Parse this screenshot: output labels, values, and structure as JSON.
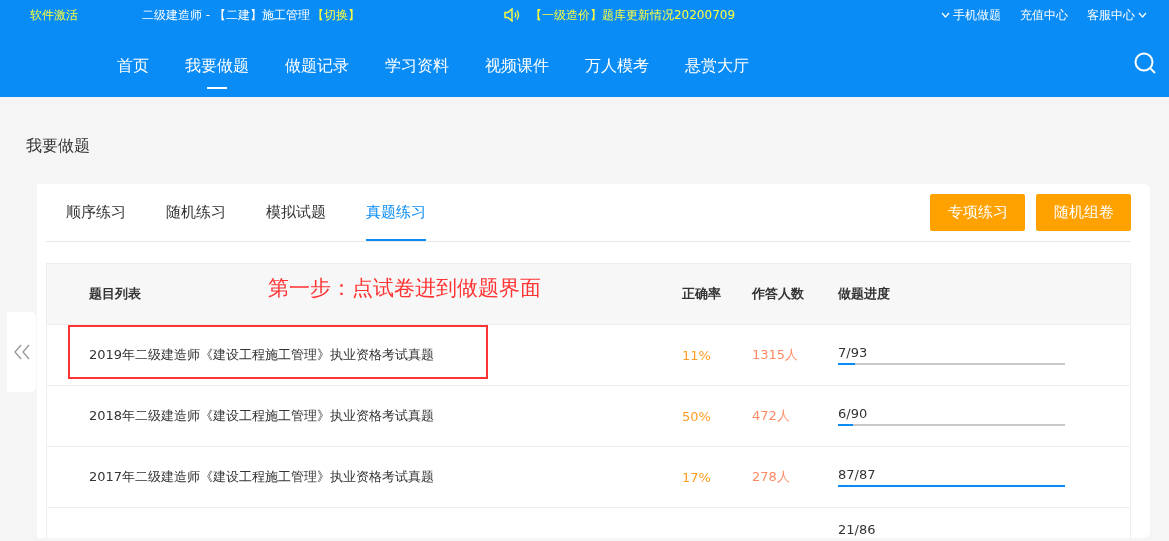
{
  "topbar": {
    "activate_link": "软件激活",
    "course": "二级建造师 - 【二建】施工管理",
    "switch_link": "【切换】",
    "notice": "【一级造价】题库更新情况20200709",
    "links": [
      {
        "label": "手机做题",
        "caret_before": true,
        "caret_after": false
      },
      {
        "label": "充值中心",
        "caret_before": false,
        "caret_after": false
      },
      {
        "label": "客服中心",
        "caret_before": false,
        "caret_after": true
      }
    ]
  },
  "nav": {
    "items": [
      {
        "label": "首页",
        "selected": false
      },
      {
        "label": "我要做题",
        "selected": true
      },
      {
        "label": "做题记录",
        "selected": false
      },
      {
        "label": "学习资料",
        "selected": false
      },
      {
        "label": "视频课件",
        "selected": false
      },
      {
        "label": "万人模考",
        "selected": false
      },
      {
        "label": "悬赏大厅",
        "selected": false
      }
    ]
  },
  "page_title": "我要做题",
  "tabs": [
    {
      "label": "顺序练习",
      "selected": false
    },
    {
      "label": "随机练习",
      "selected": false
    },
    {
      "label": "模拟试题",
      "selected": false
    },
    {
      "label": "真题练习",
      "selected": true
    }
  ],
  "buttons": [
    "专项练习",
    "随机组卷"
  ],
  "table": {
    "columns": [
      "题目列表",
      "正确率",
      "作答人数",
      "做题进度"
    ],
    "annotation": "第一步：点试卷进到做题界面",
    "rows": [
      {
        "title": "2019年二级建造师《建设工程施工管理》执业资格考试真题",
        "rate": "11%",
        "answered": "1315人",
        "progress": "7/93",
        "level": 0.075,
        "highlighted": true
      },
      {
        "title": "2018年二级建造师《建设工程施工管理》执业资格考试真题",
        "rate": "50%",
        "answered": "472人",
        "progress": "6/90",
        "level": 0.067,
        "highlighted": false
      },
      {
        "title": "2017年二级建造师《建设工程施工管理》执业资格考试真题",
        "rate": "17%",
        "answered": "278人",
        "progress": "87/87",
        "level": 1,
        "highlighted": false
      },
      {
        "progress": "21/86",
        "highlighted": false
      }
    ]
  }
}
